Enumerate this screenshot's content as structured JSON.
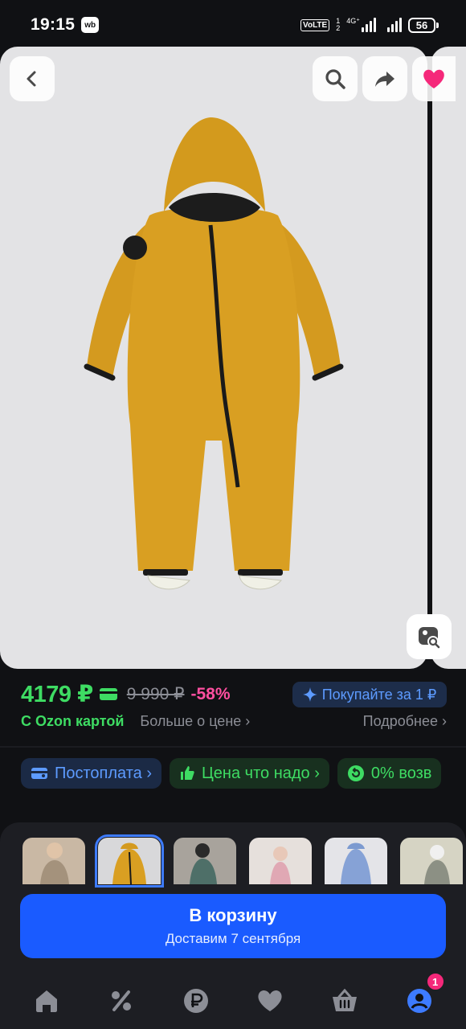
{
  "status_bar": {
    "time": "19:15",
    "app_badge": "wb",
    "volte": "VoLTE",
    "net_sim1": "1",
    "net_sim2": "2",
    "net_type": "4G⁺",
    "battery": "56"
  },
  "product": {
    "image_alt": "Yellow children's softshell jumpsuit with hood"
  },
  "price": {
    "current": "4179 ₽",
    "old": "9 990 ₽",
    "discount": "-58%",
    "card_label": "С Ozon картой",
    "more_price": "Больше о цене ›",
    "details": "Подробнее ›",
    "promo_button": "Покупайте за 1 ₽"
  },
  "chips": [
    {
      "label": "Постоплата ›",
      "icon": "wallet-icon"
    },
    {
      "label": "Цена что надо ›",
      "icon": "thumbs-up-icon"
    },
    {
      "label": "0% возв",
      "icon": "return-icon"
    }
  ],
  "cart": {
    "label": "В корзину",
    "sub": "Доставим 7 сентября"
  },
  "nav": {
    "profile_badge": "1"
  },
  "colors": {
    "accent": "#1a5bff",
    "green": "#3edc63",
    "pink": "#ff4fa0",
    "bg": "#101114"
  }
}
